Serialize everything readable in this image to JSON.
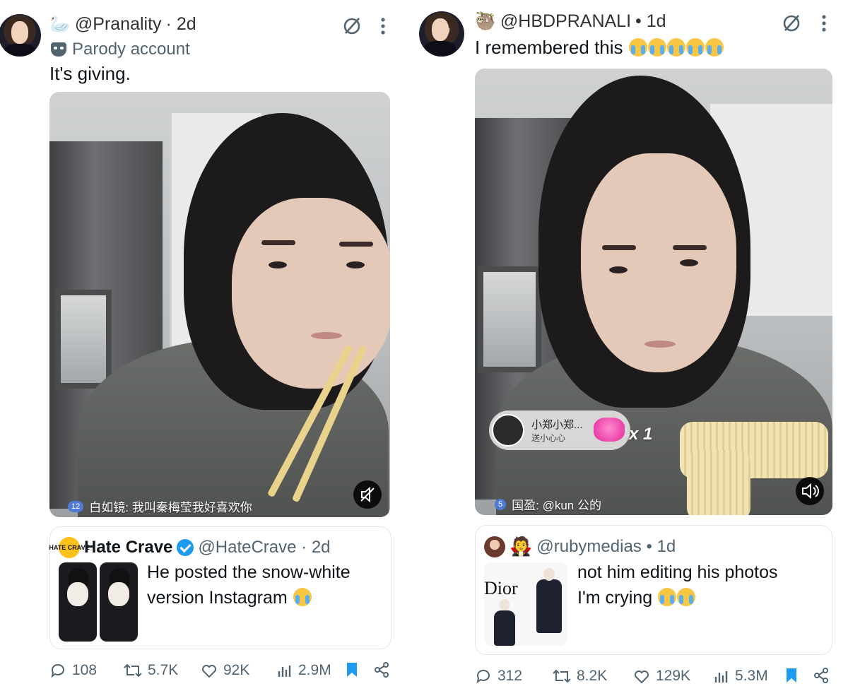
{
  "left_tweet": {
    "handle": "@Pranality",
    "time": "· 2d",
    "handle_emoji": "🦢",
    "parody_label": "Parody account",
    "text": "It's giving.",
    "video_comment": {
      "level": "12",
      "text": "白如镜:  我叫秦梅莹我好喜欢你"
    },
    "quote": {
      "name": "Hate Crave",
      "handle_time": "@HateCrave · 2d",
      "logo_text": "HATE CRAVE",
      "text_line1": "He posted the snow-white",
      "text_line2": "version Instagram"
    },
    "stats": {
      "replies": "108",
      "reposts": "5.7K",
      "likes": "92K",
      "views": "2.9M"
    }
  },
  "right_tweet": {
    "handle": "@HBDPRANALI",
    "time": "• 1d",
    "handle_emoji": "🦥",
    "text": "I remembered this",
    "gift": {
      "user": "小郑小郑...",
      "subtitle": "送小心心",
      "count": "x 1"
    },
    "video_comment": {
      "level": "5",
      "text": "国盈:  @kun  公的"
    },
    "quote": {
      "handle_time": "@rubymedias • 1d",
      "avatar_emoji": "🧛",
      "text_line1": "not him editing his photos",
      "text_line2": "I'm crying",
      "thumb_logo": "Dior"
    },
    "stats": {
      "replies": "312",
      "reposts": "8.2K",
      "likes": "129K",
      "views": "5.3M"
    }
  },
  "colors": {
    "text_primary": "#0f1419",
    "text_secondary": "#536471",
    "accent_blue": "#1d9bf0",
    "border": "#e1e8ed"
  },
  "icons": {
    "grok": "grok-icon",
    "more": "more-icon",
    "mute": "speaker-muted-icon",
    "unmute": "speaker-icon",
    "reply": "reply-icon",
    "repost": "repost-icon",
    "like": "like-icon",
    "views": "views-icon",
    "bookmark": "bookmark-icon",
    "share": "share-icon"
  }
}
